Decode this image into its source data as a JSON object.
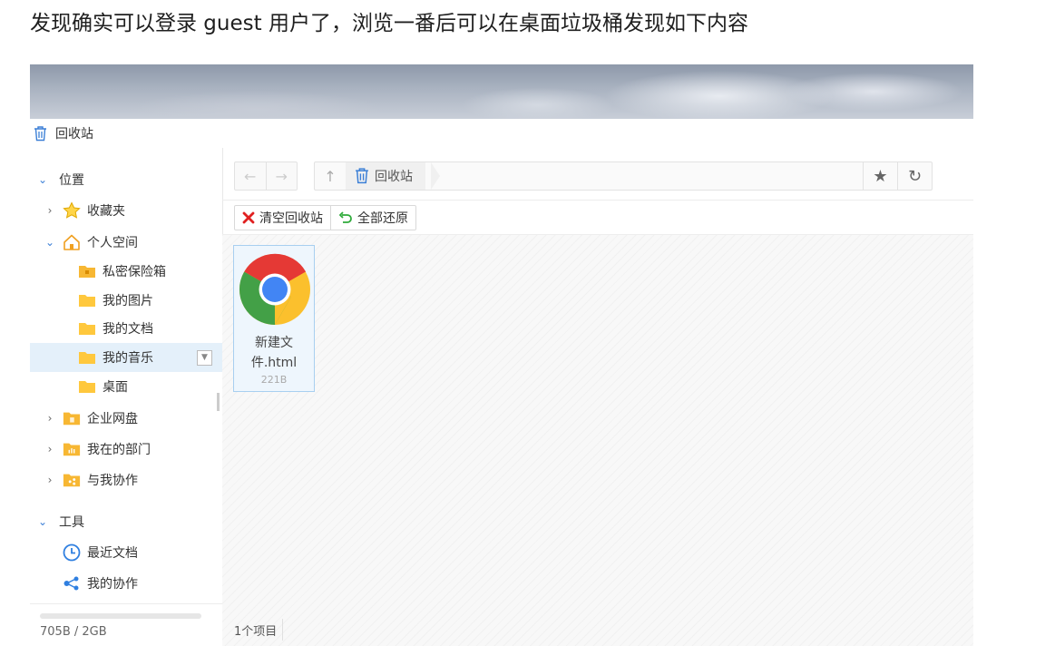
{
  "caption": "发现确实可以登录 guest 用户了，浏览一番后可以在桌面垃圾桶发现如下内容",
  "window": {
    "title": "回收站",
    "title_icon": "trash-icon"
  },
  "sidebar": {
    "location_header": "位置",
    "favorites": "收藏夹",
    "personal_space": "个人空间",
    "personal_children": [
      "私密保险箱",
      "我的图片",
      "我的文档",
      "我的音乐",
      "桌面"
    ],
    "enterprise_disk": "企业网盘",
    "my_department": "我在的部门",
    "shared_with_me": "与我协作",
    "tools_header": "工具",
    "recent_docs": "最近文档",
    "my_collab": "我的协作",
    "storage": "705B / 2GB",
    "storage_fraction": 3e-07
  },
  "address_bar": {
    "crumb": "回收站"
  },
  "toolbar": {
    "empty_trash": "清空回收站",
    "restore_all": "全部还原"
  },
  "files": [
    {
      "name": "新建文件.html",
      "name_line1": "新建文",
      "name_line2": "件.html",
      "size": "221B",
      "icon": "chrome-icon"
    }
  ],
  "status": {
    "item_count": "1个项目"
  },
  "colors": {
    "selected_bg": "#e4f0fa",
    "accent": "#4a90e2",
    "folder": "#ffc83d",
    "danger": "#e02020",
    "ok": "#2eaa3a"
  }
}
